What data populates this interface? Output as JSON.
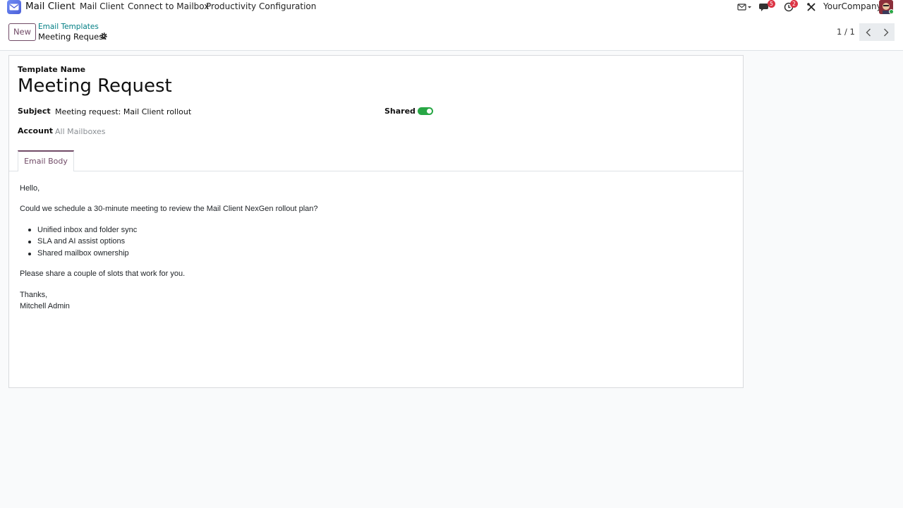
{
  "navbar": {
    "app_name": "Mail Client",
    "menu": [
      "Mail Client",
      "Connect to Mailbox",
      "Productivity",
      "Configuration"
    ],
    "messages_badge": "5",
    "activities_badge": "2",
    "company": "YourCompany"
  },
  "control": {
    "new_label": "New",
    "breadcrumb_parent": "Email Templates",
    "breadcrumb_current": "Meeting Request",
    "pager": "1 / 1"
  },
  "form": {
    "template_name_label": "Template Name",
    "template_name": "Meeting Request",
    "subject_label": "Subject",
    "subject_value": "Meeting request: Mail Client rollout",
    "shared_label": "Shared",
    "shared": true,
    "account_label": "Account",
    "account_placeholder": "All Mailboxes",
    "tab_label": "Email Body"
  },
  "email_body": {
    "greeting": "Hello,",
    "intro": "Could we schedule a 30-minute meeting to review the Mail Client NexGen rollout plan?",
    "bullets": [
      "Unified inbox and folder sync",
      "SLA and AI assist options",
      "Shared mailbox ownership"
    ],
    "request": "Please share a couple of slots that work for you.",
    "signoff": "Thanks,",
    "signature": "Mitchell Admin"
  },
  "colors": {
    "primary": "#714b67",
    "link": "#017e84",
    "toggle_on": "#28a745",
    "badge": "#dc3545"
  }
}
